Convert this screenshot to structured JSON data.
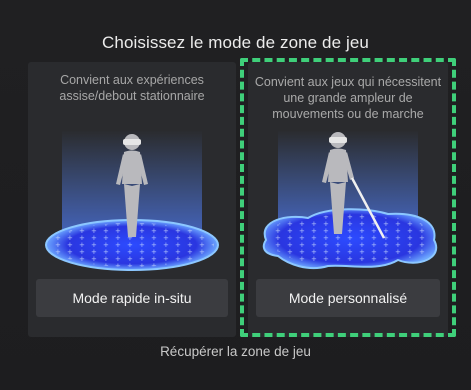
{
  "header": {
    "title": "Choisissez le mode de zone de jeu"
  },
  "options": [
    {
      "description": "Convient aux expériences assise/debout stationnaire",
      "button_label": "Mode rapide in-situ"
    },
    {
      "description": "Convient aux jeux qui nécessitent une grande ampleur de mouvements ou de marche",
      "button_label": "Mode personnalisé"
    }
  ],
  "footer": {
    "recover_label": "Récupérer la zone de jeu"
  },
  "selection": {
    "selected_option": 1,
    "highlight_color": "#3fcf7a"
  }
}
